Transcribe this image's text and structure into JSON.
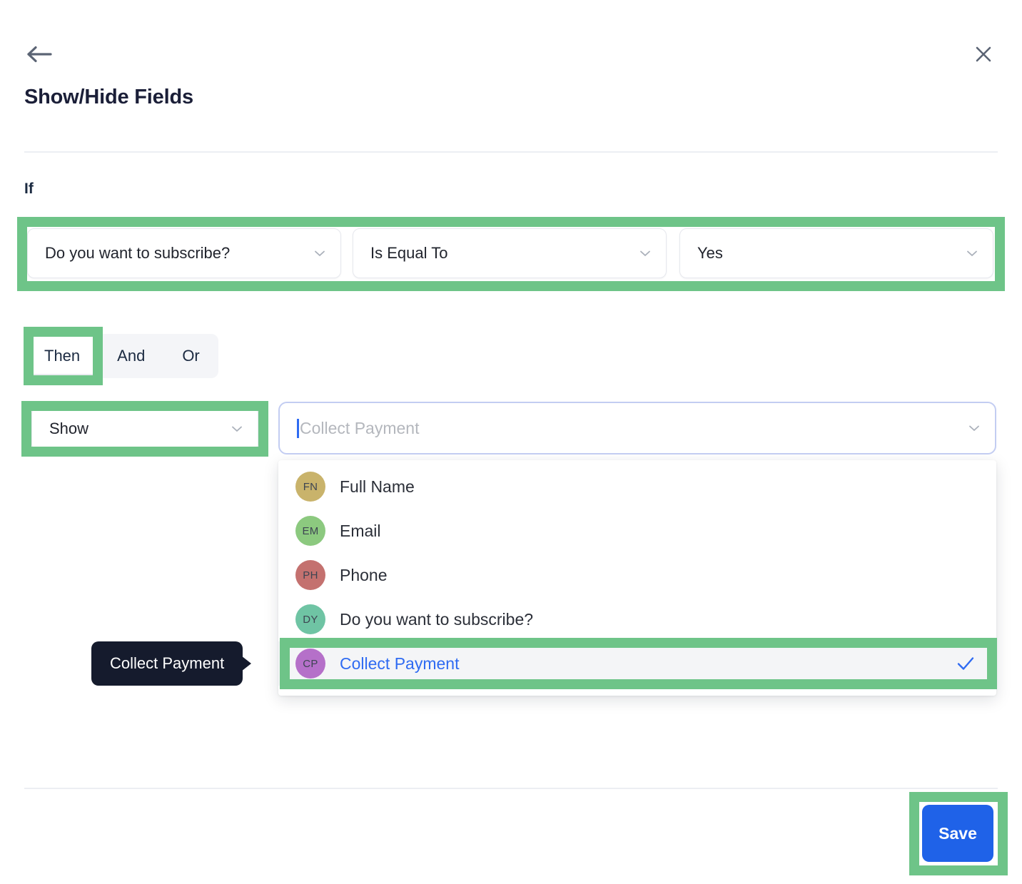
{
  "header": {
    "back_icon": "arrow-left-icon",
    "close_icon": "close-icon",
    "title": "Show/Hide Fields"
  },
  "condition": {
    "if_label": "If",
    "field_value": "Do you want to subscribe?",
    "operator_value": "Is Equal To",
    "value_value": "Yes",
    "chevron_icon": "chevron-down-icon"
  },
  "logic_tabs": {
    "items": [
      {
        "label": "Then",
        "active": true
      },
      {
        "label": "And",
        "active": false
      },
      {
        "label": "Or",
        "active": false
      }
    ]
  },
  "action": {
    "action_value": "Show",
    "target_placeholder": "Collect Payment",
    "target_value": ""
  },
  "dropdown": {
    "options": [
      {
        "initials": "FN",
        "label": "Full Name",
        "color": "#c9b36b",
        "selected": false
      },
      {
        "initials": "EM",
        "label": "Email",
        "color": "#8cc97f",
        "selected": false
      },
      {
        "initials": "PH",
        "label": "Phone",
        "color": "#c4716f",
        "selected": false
      },
      {
        "initials": "DY",
        "label": "Do you want to subscribe?",
        "color": "#6fc4a4",
        "selected": false
      },
      {
        "initials": "CP",
        "label": "Collect Payment",
        "color": "#b570c9",
        "selected": true
      }
    ],
    "check_icon": "check-icon"
  },
  "tooltip": {
    "text": "Collect Payment"
  },
  "footer": {
    "save_label": "Save"
  },
  "colors": {
    "highlight_green": "#6ec488",
    "accent_blue": "#2f6bf2",
    "save_blue": "#1f62e8",
    "tooltip_bg": "#151b2d"
  }
}
